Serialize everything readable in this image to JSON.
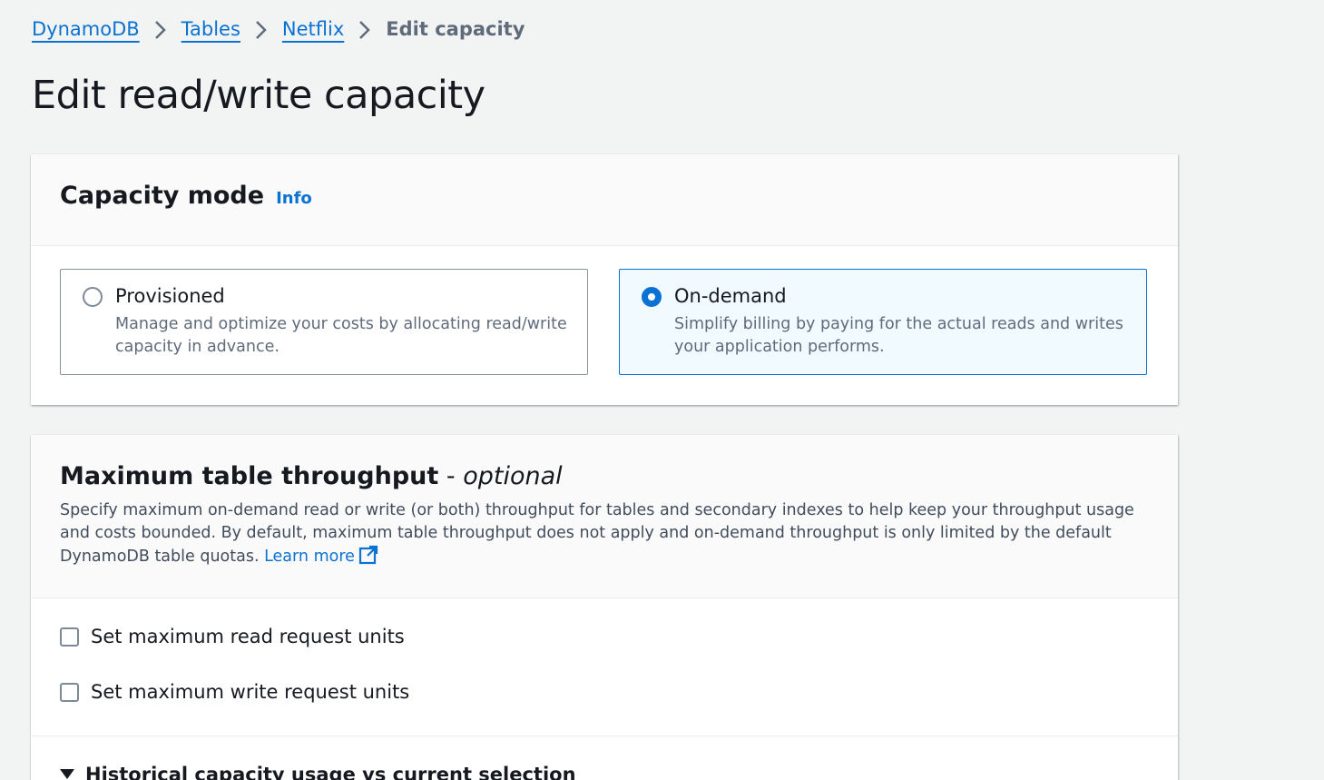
{
  "breadcrumb": {
    "items": [
      "DynamoDB",
      "Tables",
      "Netflix"
    ],
    "current": "Edit capacity"
  },
  "page_title": "Edit read/write capacity",
  "capacity_mode": {
    "title": "Capacity mode",
    "info": "Info",
    "options": [
      {
        "label": "Provisioned",
        "description": "Manage and optimize your costs by allocating read/write capacity in advance.",
        "selected": false
      },
      {
        "label": "On-demand",
        "description": "Simplify billing by paying for the actual reads and writes your application performs.",
        "selected": true
      }
    ]
  },
  "throughput": {
    "title": "Maximum table throughput",
    "dash": " - ",
    "optional": "optional",
    "description": "Specify maximum on-demand read or write (or both) throughput for tables and secondary indexes to help keep your throughput usage and costs bounded. By default, maximum table throughput does not apply and on-demand throughput is only limited by the default DynamoDB table quotas.",
    "learn_more": "Learn more",
    "checkboxes": [
      {
        "label": "Set maximum read request units",
        "checked": false
      },
      {
        "label": "Set maximum write request units",
        "checked": false
      }
    ],
    "expandable": "Historical capacity usage vs current selection"
  },
  "colors": {
    "link": "#0972d3",
    "background": "#f2f3f3",
    "selected_tile": "#f1faff"
  },
  "icons": {
    "separator": "chevron-right-icon",
    "external": "external-link-icon",
    "expand": "caret-down-icon"
  }
}
